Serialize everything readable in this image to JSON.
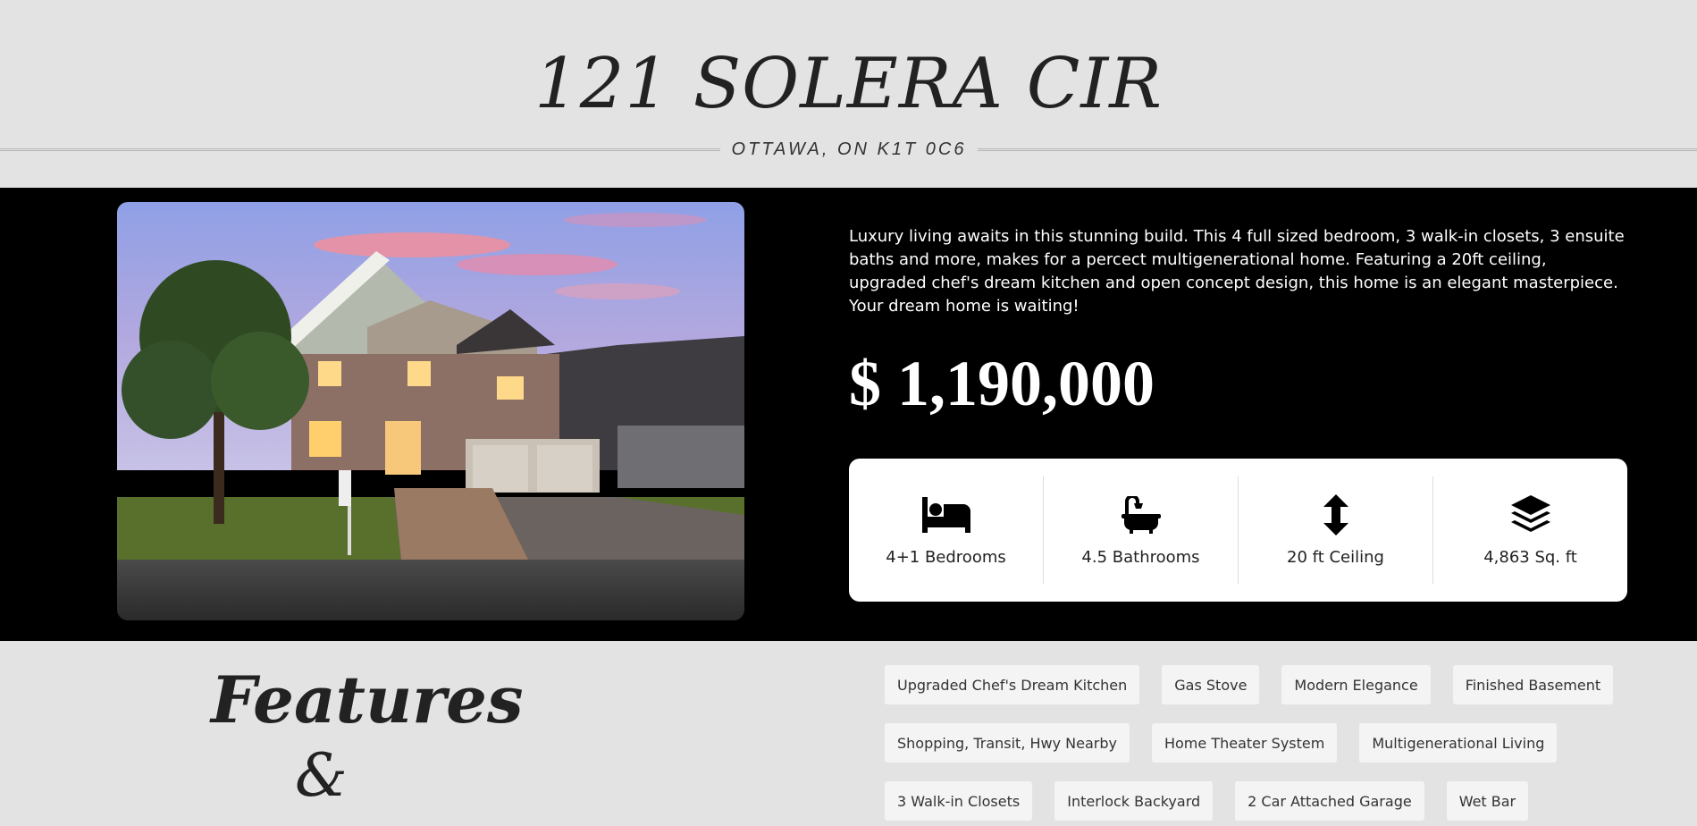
{
  "header": {
    "address": "121 SOLERA CIR",
    "city": "OTTAWA, ON K1T 0C6"
  },
  "listing": {
    "description": "Luxury living awaits in this stunning build. This 4 full sized bedroom, 3 walk-in closets, 3 ensuite baths and more, makes for a percect multigenerational home. Featuring a 20ft ceiling, upgraded chef's dream kitchen and open concept design, this home is an elegant masterpiece. Your dream home is waiting!",
    "price": "$ 1,190,000",
    "photo_icon": "house-photo"
  },
  "stats": [
    {
      "icon": "bed-icon",
      "label": "4+1 Bedrooms"
    },
    {
      "icon": "bathtub-icon",
      "label": "4.5 Bathrooms"
    },
    {
      "icon": "vertical-arrows-icon",
      "label": "20 ft Ceiling"
    },
    {
      "icon": "layers-icon",
      "label": "4,863 Sq. ft"
    }
  ],
  "features": {
    "title": "Features",
    "ampersand": "&",
    "tags": [
      "Upgraded Chef's Dream Kitchen",
      "Gas Stove",
      "Modern Elegance",
      "Finished Basement",
      "Shopping, Transit, Hwy Nearby",
      "Home Theater System",
      "Multigenerational Living",
      "3 Walk-in Closets",
      "Interlock Backyard",
      "2 Car Attached Garage",
      "Wet Bar"
    ]
  },
  "colors": {
    "background": "#e3e3e3",
    "hero": "#000000",
    "text_dark": "#222222",
    "tag_bg": "#f4f4f4"
  }
}
